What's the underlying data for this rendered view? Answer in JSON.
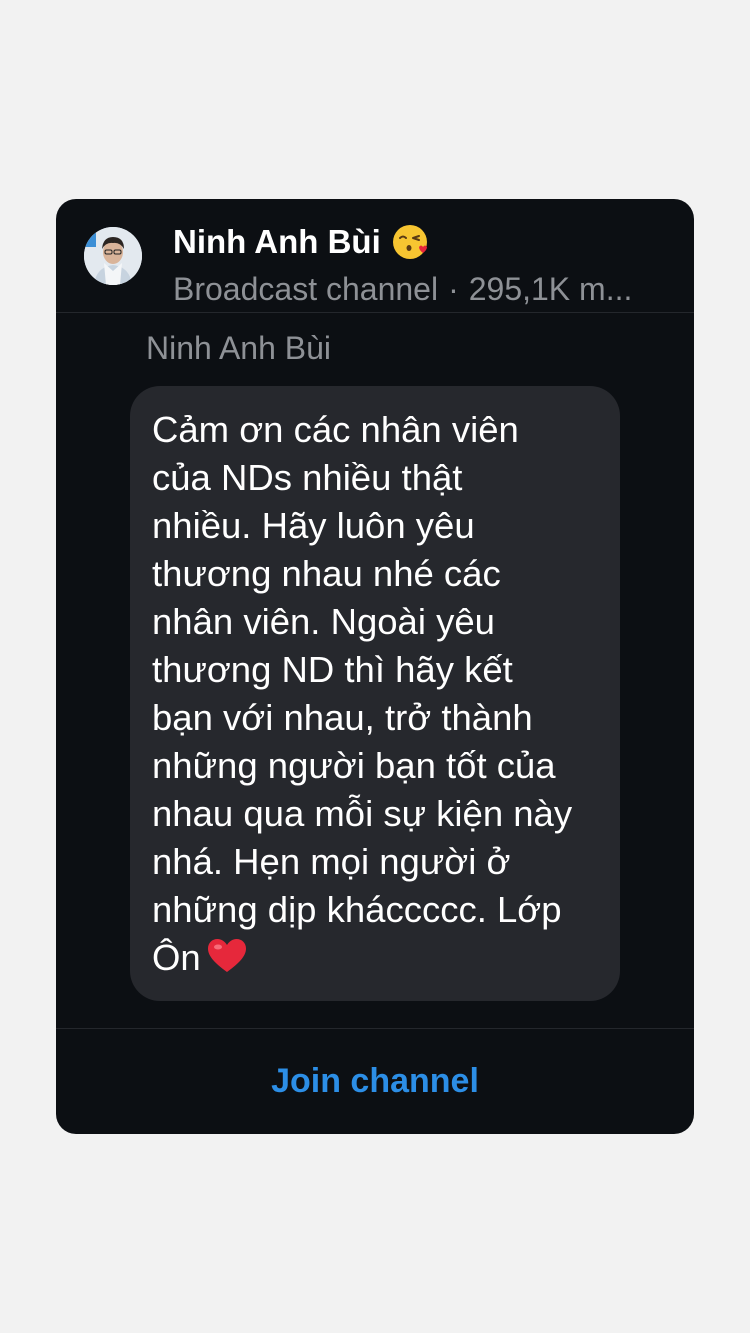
{
  "colors": {
    "background": "#f2f2f2",
    "card": "#0c0f13",
    "bubble": "#26282d",
    "accent": "#2c8ee6",
    "secondary_text": "#8e9196"
  },
  "channel": {
    "name": "Ninh Anh Bùi",
    "name_emoji": "face-blowing-a-kiss-emoji",
    "type": "Broadcast channel",
    "members": "295,1K m..."
  },
  "message": {
    "sender": "Ninh Anh Bùi",
    "text": "Cảm ơn các nhân viên\ncủa NDs nhiều thật\nnhiều. Hãy luôn yêu\nthương nhau nhé các\nnhân viên. Ngoài yêu\nthương ND thì hãy kết\nbạn với nhau, trở thành\nnhững người bạn tốt của\nnhau qua mỗi sự kiện này\nnhá. Hẹn mọi người ở\nnhững dịp kháccccc. Lớp\nÔn",
    "end_emoji": "red-heart-emoji"
  },
  "actions": {
    "join_label": "Join channel"
  }
}
